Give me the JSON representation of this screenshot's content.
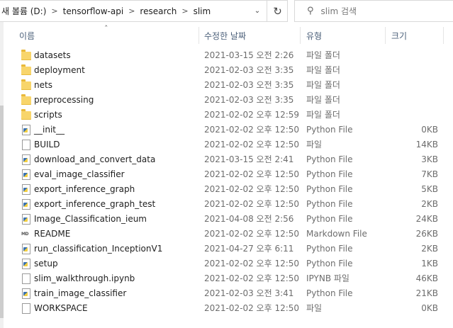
{
  "address_bar": {
    "crumbs": [
      "새 볼륨 (D:)",
      "tensorflow-api",
      "research",
      "slim"
    ],
    "dropdown_icon": "chevron-down-icon",
    "refresh_icon": "refresh-icon"
  },
  "search": {
    "placeholder": "slim 검색",
    "icon": "search-icon"
  },
  "columns": {
    "name": "이름",
    "date": "수정한 날짜",
    "type": "유형",
    "size": "크기"
  },
  "files": [
    {
      "name": "datasets",
      "date": "2021-03-15 오전 2:26",
      "type": "파일 폴더",
      "size": "",
      "icon": "folder"
    },
    {
      "name": "deployment",
      "date": "2021-02-03 오전 3:35",
      "type": "파일 폴더",
      "size": "",
      "icon": "folder"
    },
    {
      "name": "nets",
      "date": "2021-02-03 오전 3:35",
      "type": "파일 폴더",
      "size": "",
      "icon": "folder"
    },
    {
      "name": "preprocessing",
      "date": "2021-02-03 오전 3:35",
      "type": "파일 폴더",
      "size": "",
      "icon": "folder"
    },
    {
      "name": "scripts",
      "date": "2021-02-02 오후 12:59",
      "type": "파일 폴더",
      "size": "",
      "icon": "folder"
    },
    {
      "name": "__init__",
      "date": "2021-02-02 오후 12:50",
      "type": "Python File",
      "size": "0KB",
      "icon": "python"
    },
    {
      "name": "BUILD",
      "date": "2021-02-02 오후 12:50",
      "type": "파일",
      "size": "14KB",
      "icon": "file"
    },
    {
      "name": "download_and_convert_data",
      "date": "2021-03-15 오전 2:41",
      "type": "Python File",
      "size": "3KB",
      "icon": "python"
    },
    {
      "name": "eval_image_classifier",
      "date": "2021-02-02 오후 12:50",
      "type": "Python File",
      "size": "7KB",
      "icon": "python"
    },
    {
      "name": "export_inference_graph",
      "date": "2021-02-02 오후 12:50",
      "type": "Python File",
      "size": "5KB",
      "icon": "python"
    },
    {
      "name": "export_inference_graph_test",
      "date": "2021-02-02 오후 12:50",
      "type": "Python File",
      "size": "2KB",
      "icon": "python"
    },
    {
      "name": "Image_Classification_ieum",
      "date": "2021-04-08 오전 2:56",
      "type": "Python File",
      "size": "24KB",
      "icon": "python"
    },
    {
      "name": "README",
      "date": "2021-02-02 오후 12:50",
      "type": "Markdown File",
      "size": "26KB",
      "icon": "markdown"
    },
    {
      "name": "run_classification_InceptionV1",
      "date": "2021-04-27 오후 6:11",
      "type": "Python File",
      "size": "2KB",
      "icon": "python"
    },
    {
      "name": "setup",
      "date": "2021-02-02 오후 12:50",
      "type": "Python File",
      "size": "1KB",
      "icon": "python"
    },
    {
      "name": "slim_walkthrough.ipynb",
      "date": "2021-02-02 오후 12:50",
      "type": "IPYNB 파일",
      "size": "46KB",
      "icon": "file"
    },
    {
      "name": "train_image_classifier",
      "date": "2021-02-03 오전 3:41",
      "type": "Python File",
      "size": "21KB",
      "icon": "python"
    },
    {
      "name": "WORKSPACE",
      "date": "2021-02-02 오후 12:50",
      "type": "파일",
      "size": "0KB",
      "icon": "file"
    }
  ]
}
